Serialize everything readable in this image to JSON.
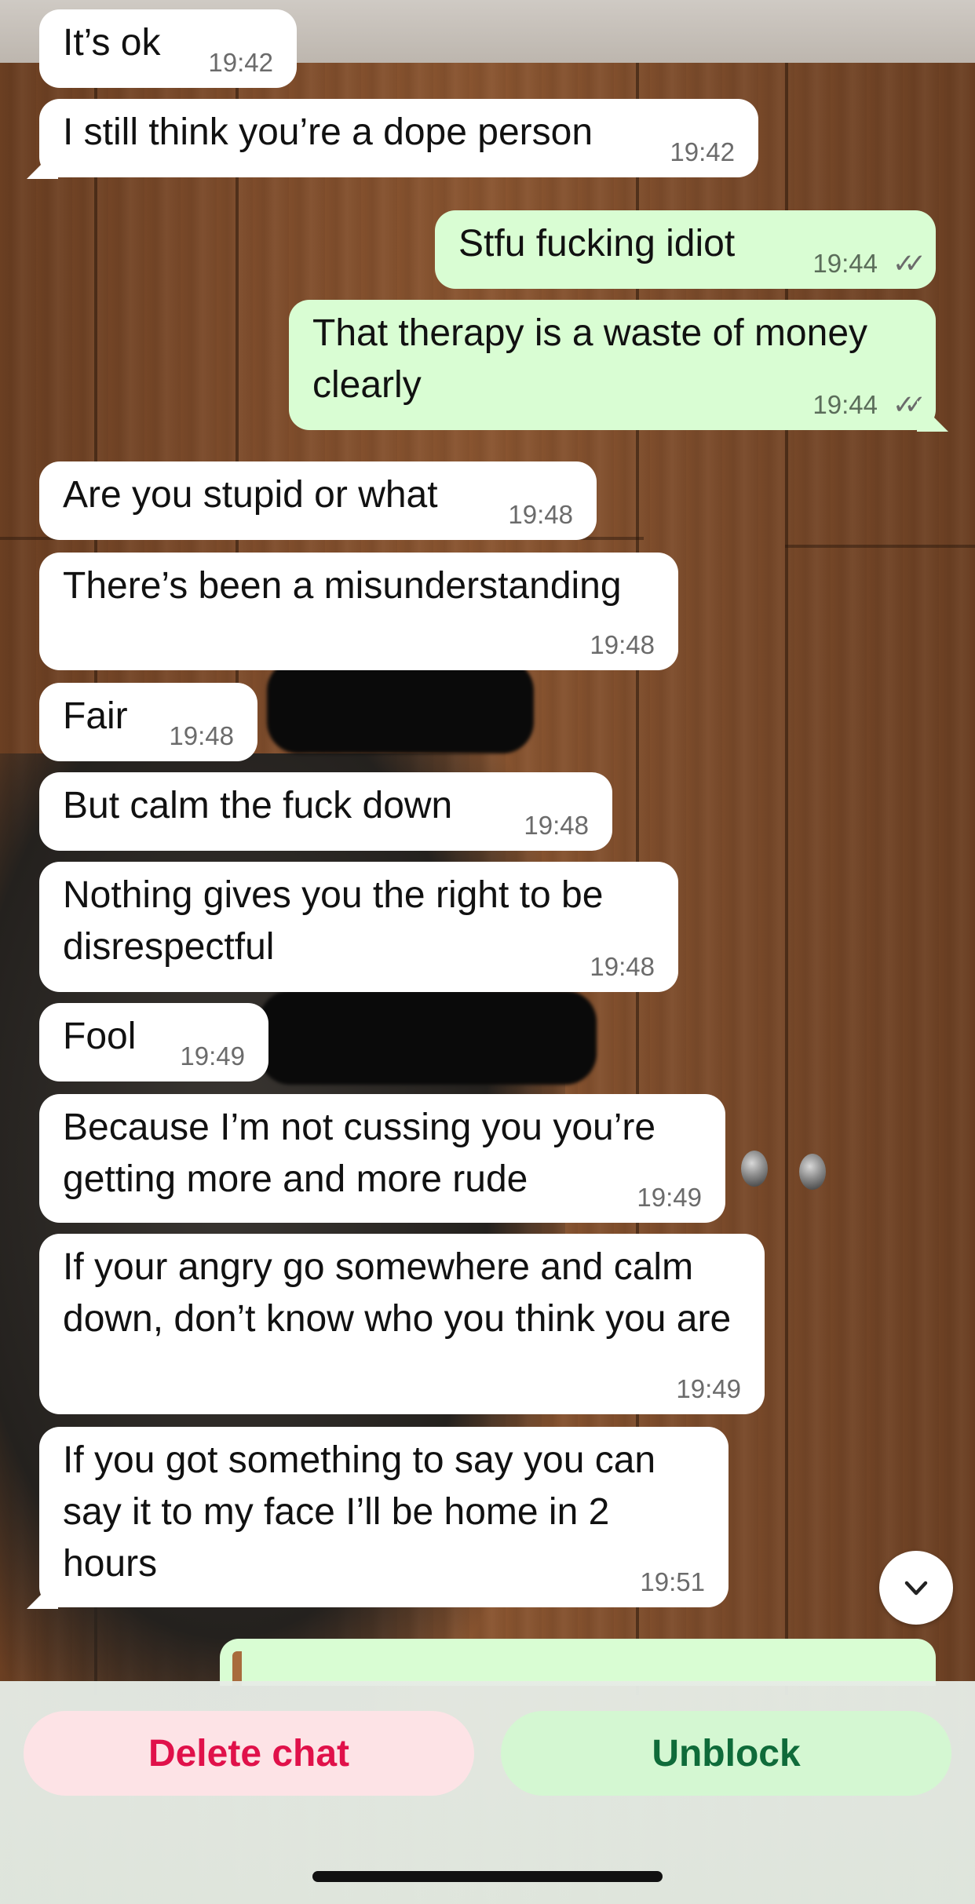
{
  "messages": [
    {
      "text": "It’s ok",
      "time": "19:42"
    },
    {
      "text": "I still think you’re a dope person",
      "time": "19:42"
    },
    {
      "text": "Stfu fucking idiot",
      "time": "19:44"
    },
    {
      "text": "That therapy is a waste of money clearly",
      "time": "19:44"
    },
    {
      "text": "Are you stupid or what",
      "time": "19:48"
    },
    {
      "text": "There’s been a misunderstanding",
      "time": "19:48"
    },
    {
      "text": "Fair",
      "time": "19:48"
    },
    {
      "text": "But calm the fuck down",
      "time": "19:48"
    },
    {
      "text": "Nothing gives you the right to be disrespectful",
      "time": "19:48"
    },
    {
      "text": "Fool",
      "time": "19:49"
    },
    {
      "text": "Because I’m not cussing you you’re getting more and more rude",
      "time": "19:49"
    },
    {
      "text": "If your angry go somewhere and calm down, don’t know who you think you are",
      "time": "19:49"
    },
    {
      "text": "If you got something to say you can say it to my face I’ll be home in 2 hours",
      "time": "19:51"
    }
  ],
  "read_receipt_icon": "double-check-icon",
  "scroll_button_icon": "chevron-down-icon",
  "actions": {
    "delete_label": "Delete chat",
    "unblock_label": "Unblock"
  },
  "colors": {
    "incoming_bubble": "#ffffff",
    "outgoing_bubble": "#d9fdd3",
    "delete_text": "#e0114a",
    "unblock_text": "#0f6b3a"
  }
}
